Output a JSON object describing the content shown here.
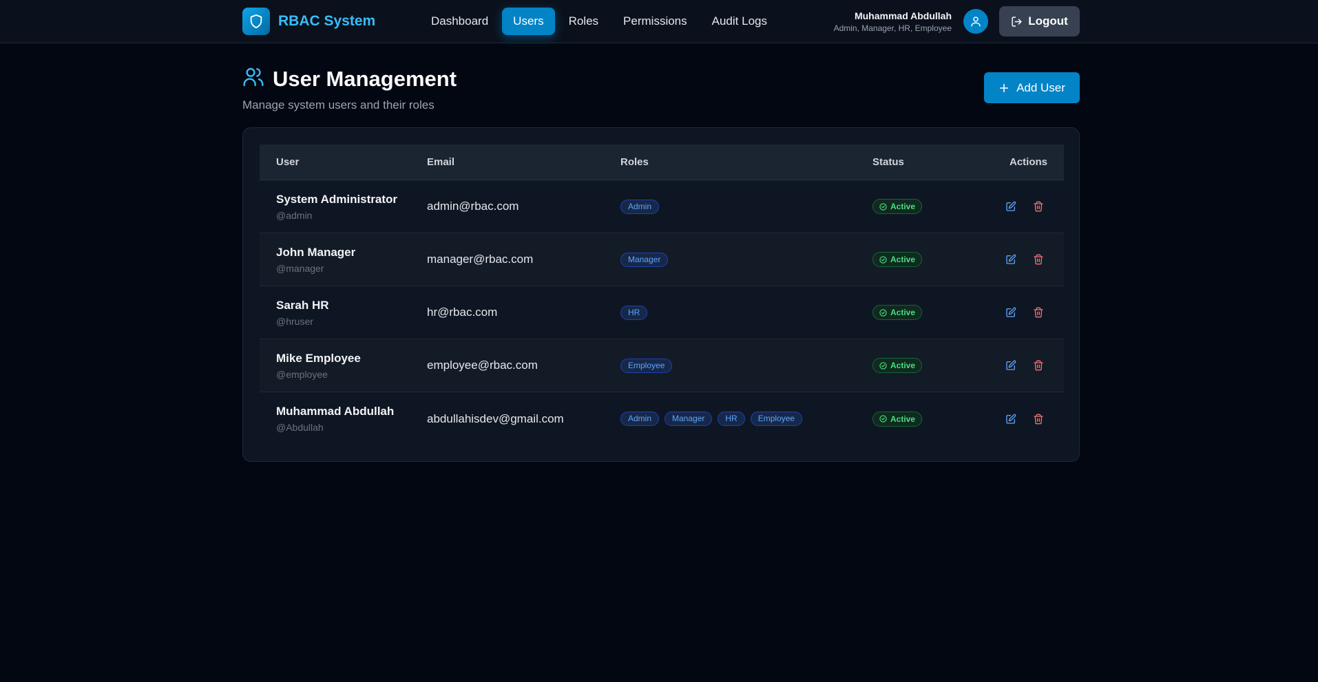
{
  "brand": {
    "name": "RBAC System",
    "icon": "shield-icon"
  },
  "nav": [
    {
      "label": "Dashboard",
      "active": false
    },
    {
      "label": "Users",
      "active": true
    },
    {
      "label": "Roles",
      "active": false
    },
    {
      "label": "Permissions",
      "active": false
    },
    {
      "label": "Audit Logs",
      "active": false
    }
  ],
  "current_user": {
    "name": "Muhammad Abdullah",
    "roles": "Admin, Manager, HR, Employee"
  },
  "logout_label": "Logout",
  "page": {
    "title": "User Management",
    "subtitle": "Manage system users and their roles",
    "add_button": "Add User"
  },
  "table": {
    "headers": {
      "user": "User",
      "email": "Email",
      "roles": "Roles",
      "status": "Status",
      "actions": "Actions"
    },
    "rows": [
      {
        "name": "System Administrator",
        "handle": "@admin",
        "email": "admin@rbac.com",
        "roles": [
          "Admin"
        ],
        "status": "Active"
      },
      {
        "name": "John Manager",
        "handle": "@manager",
        "email": "manager@rbac.com",
        "roles": [
          "Manager"
        ],
        "status": "Active"
      },
      {
        "name": "Sarah HR",
        "handle": "@hruser",
        "email": "hr@rbac.com",
        "roles": [
          "HR"
        ],
        "status": "Active"
      },
      {
        "name": "Mike Employee",
        "handle": "@employee",
        "email": "employee@rbac.com",
        "roles": [
          "Employee"
        ],
        "status": "Active"
      },
      {
        "name": "Muhammad Abdullah",
        "handle": "@Abdullah",
        "email": "abdullahisdev@gmail.com",
        "roles": [
          "Admin",
          "Manager",
          "HR",
          "Employee"
        ],
        "status": "Active"
      }
    ]
  },
  "colors": {
    "accent": "#0284c7",
    "background": "#030712",
    "success": "#4ade80",
    "danger": "#f87171"
  }
}
